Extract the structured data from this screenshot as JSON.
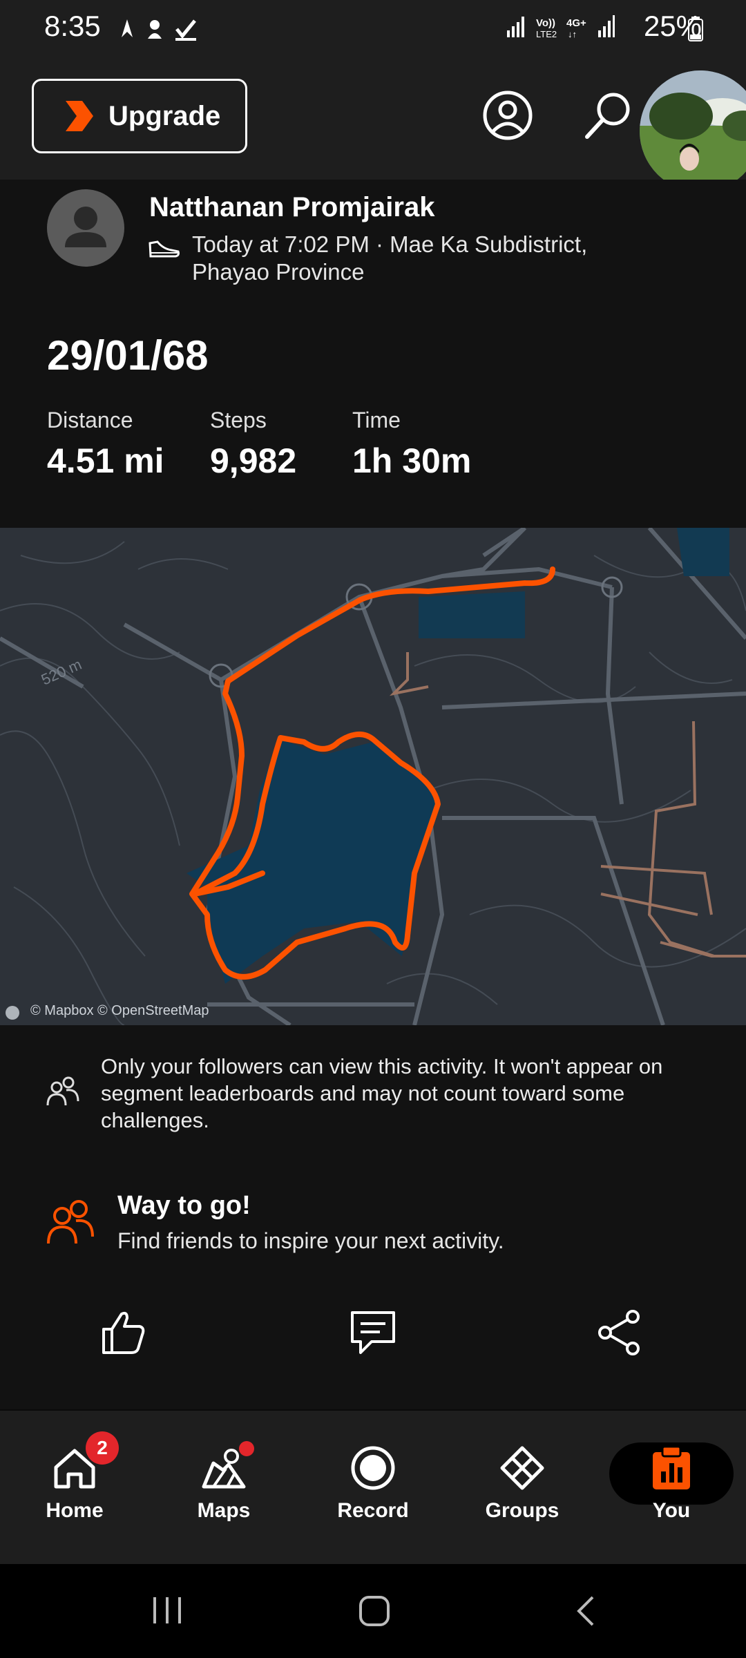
{
  "status_bar": {
    "time": "8:35",
    "battery": "25%",
    "network": "Vo) LTE2 4G+"
  },
  "header": {
    "upgrade_label": "Upgrade",
    "icons": [
      "strava-chevron-icon",
      "profile-circle-icon",
      "search-icon",
      "user-photo-avatar"
    ]
  },
  "activity": {
    "athlete_name": "Natthanan Promjairak",
    "activity_type_icon": "shoe-icon",
    "meta_line1": "Today at 7:02 PM · Mae Ka Subdistrict,",
    "meta_line2": "Phayao Province",
    "title": "29/01/68",
    "stats": [
      {
        "label": "Distance",
        "value": "4.51 mi"
      },
      {
        "label": "Steps",
        "value": "9,982"
      },
      {
        "label": "Time",
        "value": "1h 30m"
      }
    ]
  },
  "map": {
    "contour_label": "520 m",
    "credit": "© Mapbox © OpenStreetMap",
    "route_color": "#fc5200"
  },
  "privacy_notice": "Only your followers can view this activity. It won't appear on segment leaderboards and may not count toward some challenges.",
  "way_to_go": {
    "title": "Way to go!",
    "subtitle": "Find friends to inspire your next activity."
  },
  "actions": [
    "like-icon",
    "comment-icon",
    "share-icon"
  ],
  "nav": {
    "items": [
      {
        "label": "Home",
        "badge": "2"
      },
      {
        "label": "Maps"
      },
      {
        "label": "Record"
      },
      {
        "label": "Groups"
      },
      {
        "label": "You",
        "active": true
      }
    ]
  },
  "colors": {
    "accent": "#fc5200",
    "background": "#121212",
    "surface": "#1e1e1e",
    "badge": "#e3262b"
  }
}
